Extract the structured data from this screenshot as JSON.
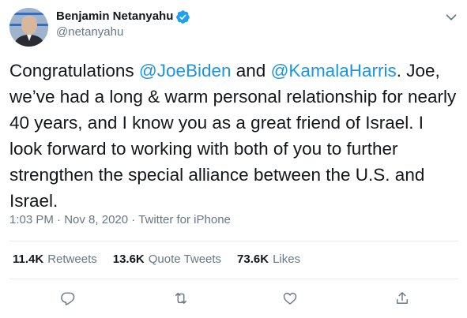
{
  "author": {
    "display_name": "Benjamin Netanyahu",
    "handle": "@netanyahu",
    "verified_icon": "verified-badge-icon"
  },
  "tweet": {
    "t1": "Congratulations ",
    "mention1": "@JoeBiden",
    "t2": " and ",
    "mention2": "@KamalaHarris",
    "t3": ". Joe, we’ve had a long & warm personal relationship for nearly 40 years, and I know you as a great friend of Israel. I look forward to working with both of you to further strengthen the special alliance between the U.S. and Israel."
  },
  "meta": {
    "time": "1:03 PM",
    "sep1": " · ",
    "date": "Nov 8, 2020",
    "sep2": " · ",
    "source": "Twitter for iPhone"
  },
  "stats": {
    "retweets_count": "11.4K",
    "retweets_label": "Retweets",
    "quotes_count": "13.6K",
    "quotes_label": "Quote Tweets",
    "likes_count": "73.6K",
    "likes_label": "Likes"
  },
  "actions": [
    "reply-icon",
    "retweet-icon",
    "like-icon",
    "share-icon"
  ],
  "colors": {
    "link": "#1b95e0",
    "secondary_text": "#657786",
    "divider": "#e6ecf0",
    "verified": "#1da1f2"
  }
}
